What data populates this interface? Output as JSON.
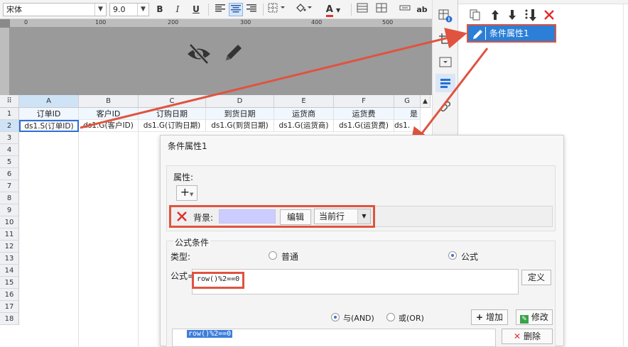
{
  "toolbar": {
    "font_name": "宋体",
    "font_size": "9.0",
    "bold": "B",
    "italic": "I",
    "underline": "U",
    "text_color_glyph": "A",
    "ab_label": "ab"
  },
  "ruler": {
    "marks": [
      "0",
      "100",
      "200",
      "300",
      "400",
      "500"
    ]
  },
  "grid": {
    "corner": "⠿",
    "columns": [
      "A",
      "B",
      "C",
      "D",
      "E",
      "F",
      "G"
    ],
    "row_numbers": [
      "1",
      "2",
      "3",
      "4",
      "5",
      "6",
      "7",
      "8",
      "9",
      "10",
      "11",
      "12",
      "13",
      "14",
      "15",
      "16",
      "17",
      "18"
    ],
    "header_row": [
      "订单ID",
      "客户ID",
      "订购日期",
      "到货日期",
      "运货商",
      "运货费",
      "是"
    ],
    "data_row": [
      "ds1.S(订单ID)",
      "ds1.G(客户ID)",
      "ds1.G(订购日期)",
      "ds1.G(到货日期)",
      "ds1.G(运货商)",
      "ds1.G(运货费)",
      "ds1."
    ]
  },
  "right_panel": {
    "condition_item": "条件属性1"
  },
  "dialog": {
    "title": "条件属性1",
    "properties_label": "属性:",
    "add_label": "+",
    "background_label": "背景:",
    "edit_button": "编辑",
    "scope_select": "当前行",
    "formula_condition_label": "公式条件",
    "type_label": "类型:",
    "radio_normal": "普通",
    "radio_formula": "公式",
    "formula_label": "公式=",
    "formula_value": "row()%2==0",
    "define_button": "定义",
    "and_label": "与(AND)",
    "or_label": "或(OR)",
    "add_button": "增加",
    "modify_button": "修改",
    "delete_button": "删除",
    "condition_list": [
      "row()%2==0"
    ]
  },
  "colors": {
    "accent": "#2b7fd6",
    "highlight": "#e0533f",
    "background_swatch": "#ccccff"
  }
}
